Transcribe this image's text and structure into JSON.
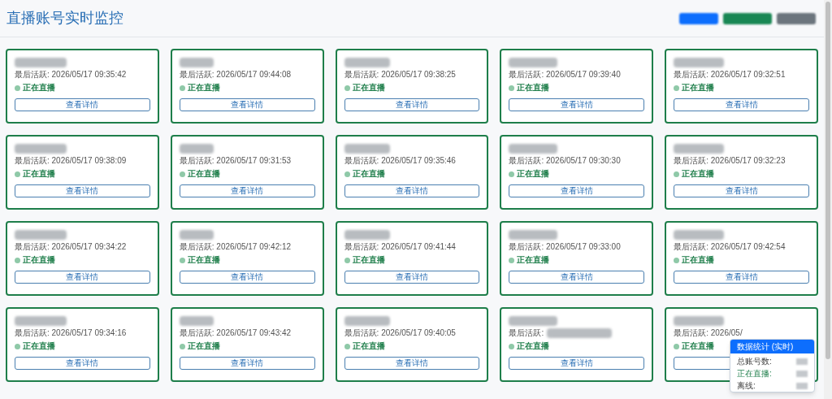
{
  "header": {
    "title": "直播账号实时监控",
    "buttons": [
      {
        "color": "#0d6efd"
      },
      {
        "color": "#198754"
      },
      {
        "color": "#6c757d"
      }
    ]
  },
  "cards": [
    {
      "last_active": "最后活跃: 2026/05/17 09:35:42",
      "status": "正在直播",
      "live": true,
      "button": "查看详情"
    },
    {
      "last_active": "最后活跃: 2026/05/17 09:44:08",
      "status": "正在直播",
      "live": true,
      "button": "查看详情"
    },
    {
      "last_active": "最后活跃: 2026/05/17 09:38:25",
      "status": "正在直播",
      "live": true,
      "button": "查看详情"
    },
    {
      "last_active": "最后活跃: 2026/05/17 09:39:40",
      "status": "正在直播",
      "live": true,
      "button": "查看详情"
    },
    {
      "last_active": "最后活跃: 2026/05/17 09:32:51",
      "status": "正在直播",
      "live": true,
      "button": "查看详情"
    },
    {
      "last_active": "最后活跃: 2026/05/17 09:38:09",
      "status": "正在直播",
      "live": true,
      "button": "查看详情"
    },
    {
      "last_active": "最后活跃: 2026/05/17 09:31:53",
      "status": "正在直播",
      "live": true,
      "button": "查看详情"
    },
    {
      "last_active": "最后活跃: 2026/05/17 09:35:46",
      "status": "正在直播",
      "live": true,
      "button": "查看详情"
    },
    {
      "last_active": "最后活跃: 2026/05/17 09:30:30",
      "status": "正在直播",
      "live": true,
      "button": "查看详情"
    },
    {
      "last_active": "最后活跃: 2026/05/17 09:32:23",
      "status": "正在直播",
      "live": true,
      "button": "查看详情"
    },
    {
      "last_active": "最后活跃: 2026/05/17 09:34:22",
      "status": "正在直播",
      "live": true,
      "button": "查看详情"
    },
    {
      "last_active": "最后活跃: 2026/05/17 09:42:12",
      "status": "正在直播",
      "live": true,
      "button": "查看详情"
    },
    {
      "last_active": "最后活跃: 2026/05/17 09:41:44",
      "status": "正在直播",
      "live": true,
      "button": "查看详情"
    },
    {
      "last_active": "最后活跃: 2026/05/17 09:33:00",
      "status": "正在直播",
      "live": true,
      "button": "查看详情"
    },
    {
      "last_active": "最后活跃: 2026/05/17 09:42:54",
      "status": "正在直播",
      "live": true,
      "button": "查看详情"
    },
    {
      "last_active": "最后活跃: 2026/05/17 09:34:16",
      "status": "正在直播",
      "live": true,
      "button": "查看详情"
    },
    {
      "last_active": "最后活跃: 2026/05/17 09:43:42",
      "status": "正在直播",
      "live": true,
      "button": "查看详情"
    },
    {
      "last_active": "最后活跃: 2026/05/17 09:40:05",
      "status": "正在直播",
      "live": true,
      "button": "查看详情"
    },
    {
      "last_active": "最后活跃:",
      "status": "正在直播",
      "live": true,
      "button": "查看详情"
    },
    {
      "last_active": "最后活跃: 2026/05/",
      "status": "正在直播",
      "live": true
    }
  ],
  "stats_panel": {
    "title": "数据统计 (实时)",
    "rows": [
      {
        "label": "总账号数:",
        "kind": "total"
      },
      {
        "label": "正在直播:",
        "kind": "live"
      },
      {
        "label": "离线:",
        "kind": "offline"
      }
    ]
  }
}
